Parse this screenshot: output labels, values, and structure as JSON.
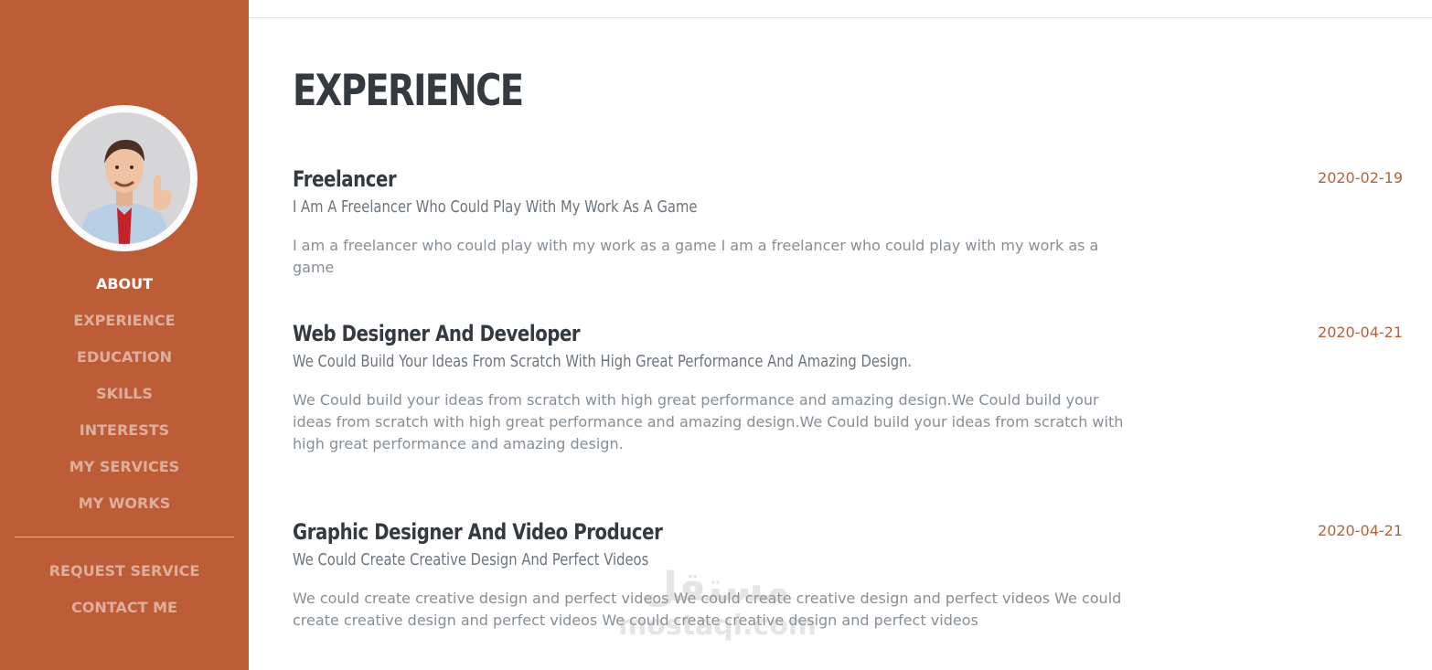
{
  "sidebar": {
    "bg_color": "#bd5d38",
    "avatar": {
      "alt": "profile photo"
    },
    "nav_items": [
      {
        "label": "ABOUT",
        "active": true
      },
      {
        "label": "EXPERIENCE",
        "active": false
      },
      {
        "label": "EDUCATION",
        "active": false
      },
      {
        "label": "SKILLS",
        "active": false
      },
      {
        "label": "INTERESTS",
        "active": false
      },
      {
        "label": "MY SERVICES",
        "active": false
      },
      {
        "label": "MY WORKS",
        "active": false
      }
    ],
    "secondary_items": [
      {
        "label": "REQUEST SERVICE"
      },
      {
        "label": "CONTACT ME"
      }
    ]
  },
  "main": {
    "title": "EXPERIENCE",
    "entries": [
      {
        "role": "Freelancer",
        "subtitle": "I Am A Freelancer Who Could Play With My Work As A Game",
        "description": "I am a freelancer who could play with my work as a game I am a freelancer who could play with my work as a game",
        "date": "2020-02-19"
      },
      {
        "role": "Web Designer And Developer",
        "subtitle": "We Could Build Your Ideas From Scratch With High Great Performance And Amazing Design.",
        "description": "We Could build your ideas from scratch with high great performance and amazing design.We Could build your ideas from scratch with high great performance and amazing design.We Could build your ideas from scratch with high great performance and amazing design.",
        "date": "2020-04-21"
      },
      {
        "role": "Graphic Designer And Video Producer",
        "subtitle": "We Could Create Creative Design And Perfect Videos",
        "description": "We could create creative design and perfect videos We could create creative design and perfect videos We could create creative design and perfect videos We could create creative design and perfect videos",
        "date": "2020-04-21"
      }
    ]
  },
  "watermark": {
    "arabic": "مستقل",
    "latin": "mostaqi.com"
  },
  "colors": {
    "accent": "#bd5d38",
    "heading": "#343a40",
    "muted": "#868e96"
  }
}
